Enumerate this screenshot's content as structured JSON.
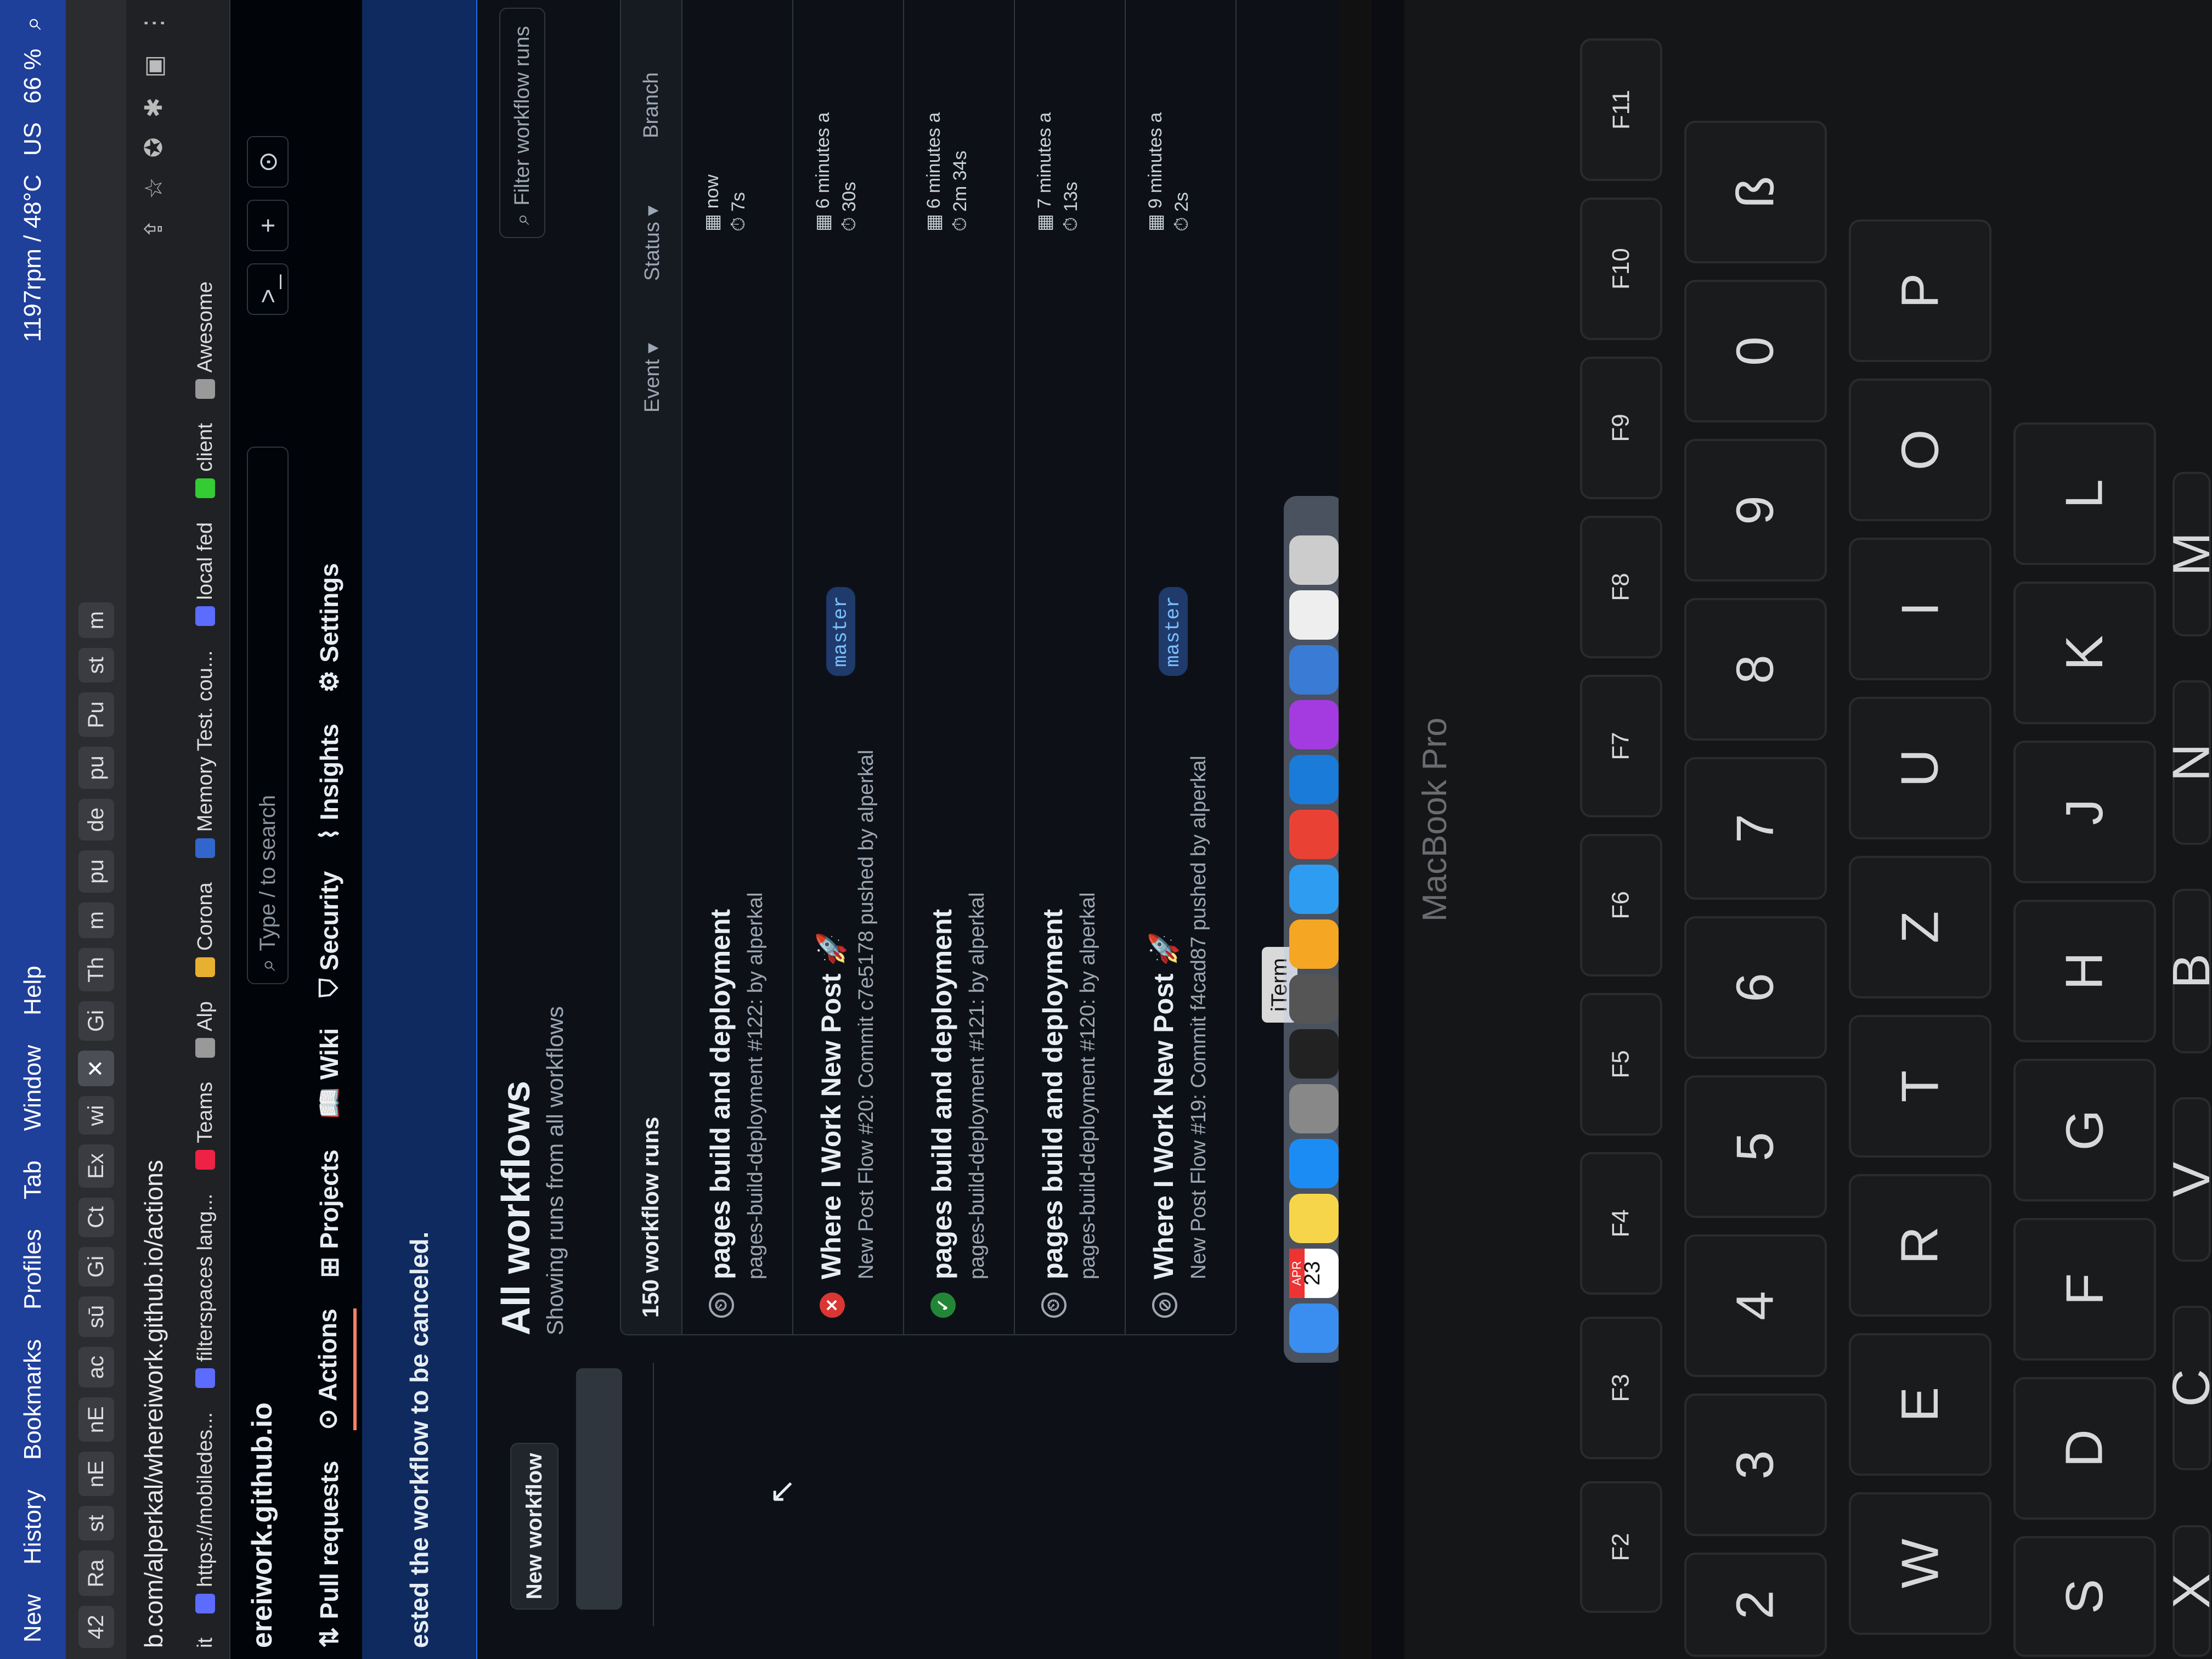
{
  "menubar": {
    "items": [
      "New",
      "History",
      "Bookmarks",
      "Profiles",
      "Tab",
      "Window",
      "Help"
    ],
    "status": [
      "1197rpm / 48°C",
      "US",
      "66 %"
    ]
  },
  "tabs": [
    "42",
    "Ra",
    "st",
    "nE",
    "nE",
    "ac",
    "sū",
    "Gi",
    "Ct",
    "Ex",
    "wi",
    "Gi",
    "Th",
    "m",
    "pu",
    "de",
    "pu",
    "Pu",
    "st",
    "m"
  ],
  "address": {
    "url": "b.com/alperkal/whereiwork.github.io/actions"
  },
  "bookmarks": [
    "it",
    "https://mobiledes...",
    "filterspaces lang...",
    "Teams",
    "Alp",
    "Corona",
    "Memory Test. cou...",
    "local fed",
    "client",
    "Awesome"
  ],
  "header": {
    "repo": "ereiwork.github.io",
    "search_label": "Type / to search",
    "nav": [
      "Pull requests",
      "Actions",
      "Projects",
      "Wiki",
      "Security",
      "Insights",
      "Settings"
    ]
  },
  "flash": {
    "message": "ested the workflow to be canceled."
  },
  "sidebar": {
    "new_workflow": "New workflow"
  },
  "main": {
    "title": "All workflows",
    "subtitle": "Showing runs from all workflows",
    "filter_placeholder": "Filter workflow runs",
    "run_count": "150 workflow runs",
    "filters": [
      "Event",
      "Status",
      "Branch"
    ],
    "runs": [
      {
        "status": "queued",
        "title": "pages build and deployment",
        "desc": "pages-build-deployment #122: by alperkal",
        "branch": "",
        "time": "now",
        "duration": "7s"
      },
      {
        "status": "failure",
        "title": "Where I Work New Post 🚀",
        "desc": "New Post Flow #20: Commit c7e5178 pushed by alperkal",
        "branch": "master",
        "time": "6 minutes a",
        "duration": "30s"
      },
      {
        "status": "success",
        "title": "pages build and deployment",
        "desc": "pages-build-deployment #121: by alperkal",
        "branch": "",
        "time": "6 minutes a",
        "duration": "2m 34s"
      },
      {
        "status": "queued",
        "title": "pages build and deployment",
        "desc": "pages-build-deployment #120: by alperkal",
        "branch": "",
        "time": "7 minutes a",
        "duration": "13s"
      },
      {
        "status": "cancelled",
        "title": "Where I Work New Post 🚀",
        "desc": "New Post Flow #19: Commit f4cad87 pushed by alperkal",
        "branch": "master",
        "time": "9 minutes a",
        "duration": "2s"
      }
    ]
  },
  "dock": {
    "tooltip": "iTerm",
    "calendar_month": "APR",
    "calendar_day": "23"
  },
  "device": {
    "brand": "MacBook Pro"
  },
  "keys": [
    "F2",
    "F3",
    "F4",
    "F5",
    "F6",
    "F7",
    "F8",
    "F9",
    "F10",
    "F11",
    "2",
    "3",
    "4",
    "5",
    "6",
    "7",
    "8",
    "9",
    "0",
    "ß",
    "W",
    "E",
    "R",
    "T",
    "Z",
    "U",
    "I",
    "O",
    "P",
    "S",
    "D",
    "F",
    "G",
    "H",
    "J",
    "K",
    "L",
    "X",
    "C",
    "V",
    "B",
    "N",
    "M"
  ]
}
